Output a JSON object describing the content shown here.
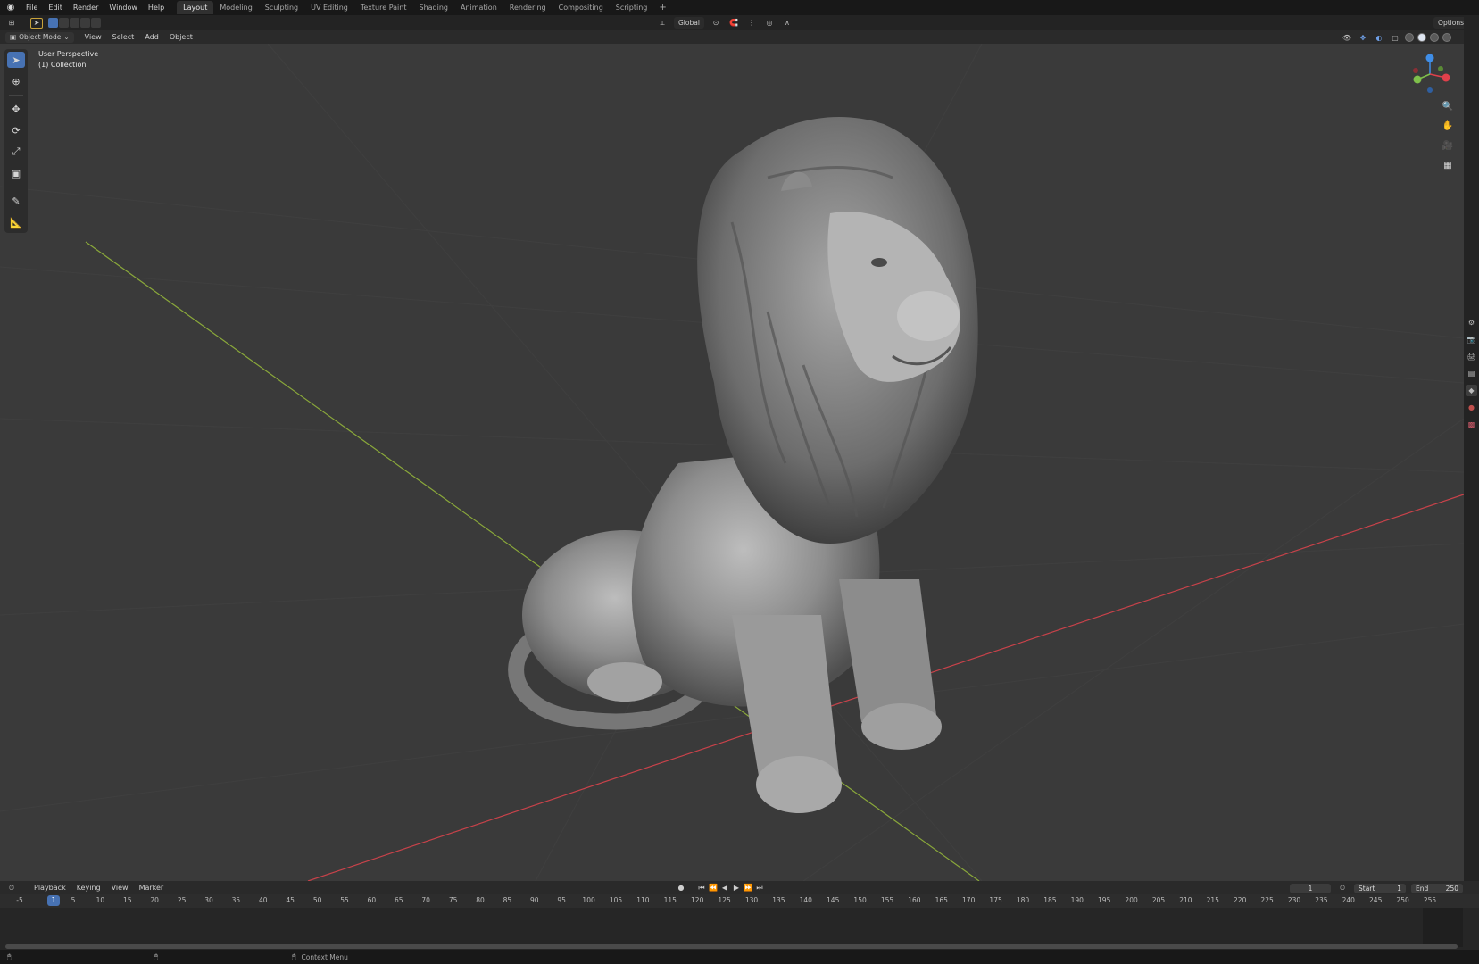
{
  "menu": {
    "items": [
      "File",
      "Edit",
      "Render",
      "Window",
      "Help"
    ]
  },
  "workspaces": {
    "tabs": [
      "Layout",
      "Modeling",
      "Sculpting",
      "UV Editing",
      "Texture Paint",
      "Shading",
      "Animation",
      "Rendering",
      "Compositing",
      "Scripting"
    ],
    "active": "Layout",
    "add": "+"
  },
  "tool_header": {
    "orientation": "Global",
    "options": "Options"
  },
  "viewport_header": {
    "mode": "Object Mode",
    "menus": [
      "View",
      "Select",
      "Add",
      "Object"
    ]
  },
  "viewport": {
    "perspective_label": "User Perspective",
    "collection_label": "(1) Collection",
    "gizmo_axes": {
      "x": "#e0404b",
      "y": "#7fc04b",
      "z": "#3f8ee8"
    }
  },
  "timeline": {
    "menus": [
      "Playback",
      "Keying",
      "View",
      "Marker"
    ],
    "current_frame": "1",
    "start_label": "Start",
    "start_value": "1",
    "end_label": "End",
    "end_value": "250",
    "ticks": [
      "-5",
      "5",
      "10",
      "15",
      "20",
      "25",
      "30",
      "35",
      "40",
      "45",
      "50",
      "55",
      "60",
      "65",
      "70",
      "75",
      "80",
      "85",
      "90",
      "95",
      "100",
      "105",
      "110",
      "115",
      "120",
      "125",
      "130",
      "135",
      "140",
      "145",
      "150",
      "155",
      "160",
      "165",
      "170",
      "175",
      "180",
      "185",
      "190",
      "195",
      "200",
      "205",
      "210",
      "215",
      "220",
      "225",
      "230",
      "235",
      "240",
      "245",
      "250",
      "255"
    ]
  },
  "statusbar": {
    "context_menu": "Context Menu"
  },
  "colors": {
    "accent": "#4772b3",
    "axis_x": "#c8424a",
    "axis_y": "#8aa83a"
  }
}
